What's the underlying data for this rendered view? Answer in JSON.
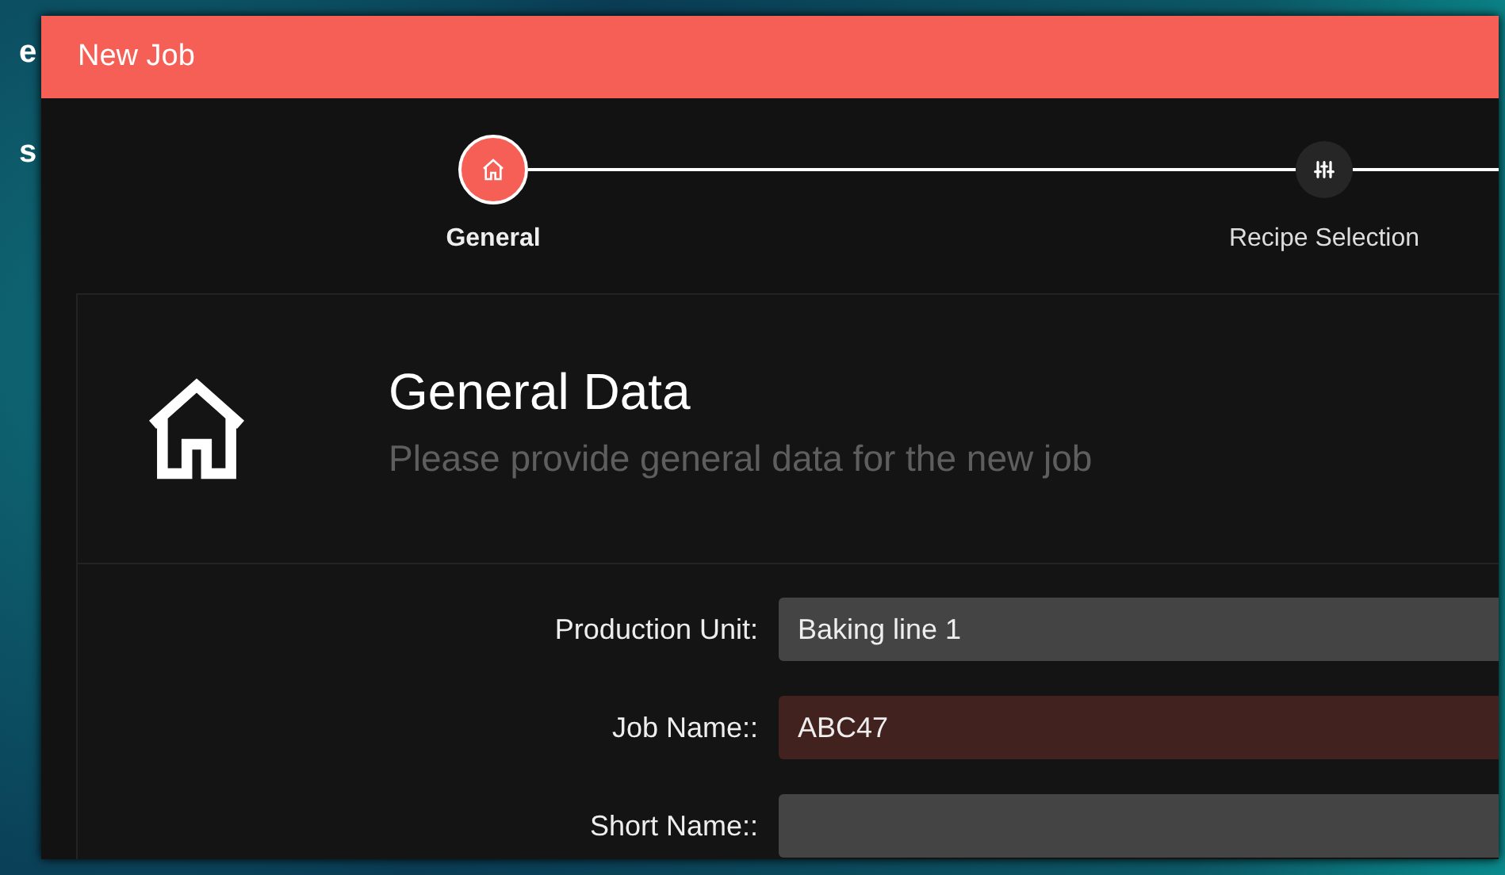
{
  "background_texts": [
    "e",
    "s"
  ],
  "window": {
    "title": "New Job"
  },
  "steps": [
    {
      "label": "General",
      "kind": "home",
      "selected": true
    },
    {
      "label": "Recipe Selection",
      "kind": "sliders",
      "selected": false
    }
  ],
  "section": {
    "title": "General Data",
    "subtitle": "Please provide general data for the new job"
  },
  "fields": [
    {
      "label": "Production Unit:",
      "value": "Baking line 1",
      "invalid": false
    },
    {
      "label": "Job Name::",
      "value": "ABC47",
      "invalid": true
    },
    {
      "label": "Short Name::",
      "invalid": false
    }
  ]
}
